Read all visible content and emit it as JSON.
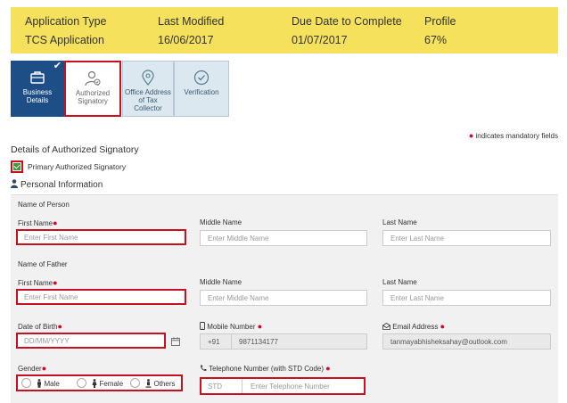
{
  "header": {
    "columns": [
      {
        "label": "Application Type",
        "value": "TCS Application"
      },
      {
        "label": "Last Modified",
        "value": "16/06/2017"
      },
      {
        "label": "Due Date to Complete",
        "value": "01/07/2017"
      },
      {
        "label": "Profile",
        "value": "67%"
      }
    ]
  },
  "tabs": [
    {
      "label": "Business Details",
      "icon": "briefcase-icon",
      "state": "completed"
    },
    {
      "label": "Authorized Signatory",
      "icon": "user-check-icon",
      "state": "current"
    },
    {
      "label": "Office Address of Tax Collector",
      "icon": "location-pin-icon",
      "state": "pending"
    },
    {
      "label": "Verification",
      "icon": "check-circle-icon",
      "state": "pending"
    }
  ],
  "mandatory_note": "indicates mandatory fields",
  "section_title": "Details of Authorized Signatory",
  "primary_signatory": {
    "label": "Primary Authorized Signatory",
    "checked": true
  },
  "personal_info_title": "Personal Information",
  "name_of_person": {
    "heading": "Name of Person",
    "first_label": "First Name",
    "first_placeholder": "Enter First Name",
    "middle_label": "Middle Name",
    "middle_placeholder": "Enter Middle Name",
    "last_label": "Last Name",
    "last_placeholder": "Enter Last Name"
  },
  "name_of_father": {
    "heading": "Name of Father",
    "first_label": "First Name",
    "first_placeholder": "Enter First Name",
    "middle_label": "Middle Name",
    "middle_placeholder": "Enter Middle Name",
    "last_label": "Last Name",
    "last_placeholder": "Enter Last Name"
  },
  "dob": {
    "label": "Date of Birth",
    "placeholder": "DD/MM/YYYY"
  },
  "mobile": {
    "label": "Mobile Number",
    "prefix": "+91",
    "value": "9871134177"
  },
  "email": {
    "label": "Email Address",
    "value": "tanmayabhisheksahay@outlook.com"
  },
  "gender": {
    "label": "Gender",
    "options": [
      "Male",
      "Female",
      "Others"
    ]
  },
  "telephone": {
    "label": "Telephone Number (with STD Code)",
    "std_placeholder": "STD",
    "number_placeholder": "Enter Telephone Number"
  },
  "colors": {
    "header_bg": "#f5e15c",
    "active_tab": "#1e4e86",
    "error_border": "#c8101f",
    "required": "#d9002a"
  }
}
